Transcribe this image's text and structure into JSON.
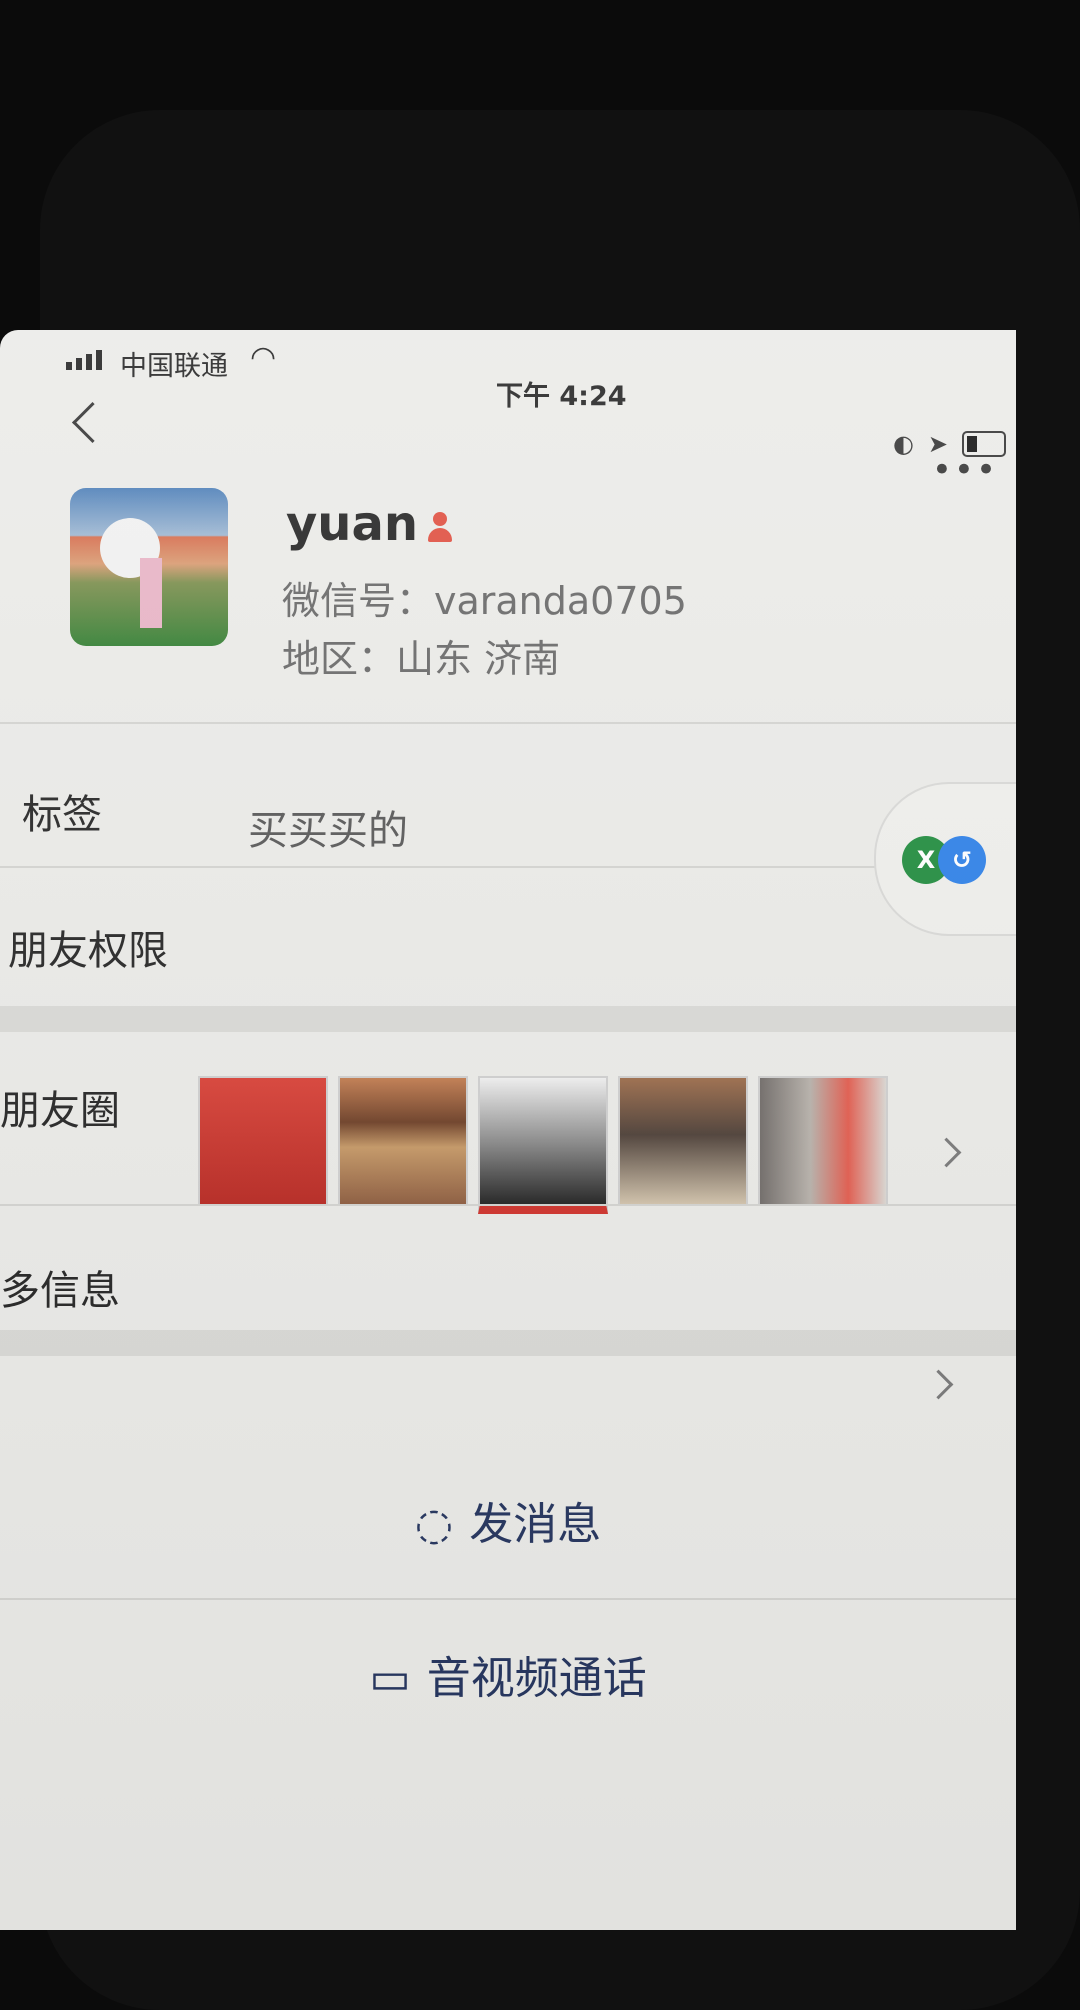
{
  "status_bar": {
    "carrier": "中国联通",
    "time": "下午 4:24"
  },
  "profile": {
    "name": "yuan",
    "wechat_id": "微信号：varanda0705",
    "region": "地区：山东 济南",
    "person_icon": "person-icon"
  },
  "tags": {
    "label": "标签",
    "value": "买买买的"
  },
  "friend_permissions": {
    "label": "朋友权限"
  },
  "moments": {
    "label": "朋友圈",
    "photo_count": 5
  },
  "more_info": {
    "label": "多信息"
  },
  "actions": {
    "message": "发消息",
    "video_call": "音视频通话"
  },
  "floating_badges": {
    "left": "X",
    "right": "↺"
  },
  "colors": {
    "screen_bg": "#ebebe8",
    "text": "#222222",
    "secondary_text": "#666666",
    "action_text": "#24345e",
    "accent_red": "#e04e3f"
  },
  "icons": {
    "back": "back-icon",
    "more": "more-icon",
    "chat": "chat-icon",
    "video": "video-icon",
    "wifi": "wifi-icon",
    "battery": "battery-icon"
  }
}
